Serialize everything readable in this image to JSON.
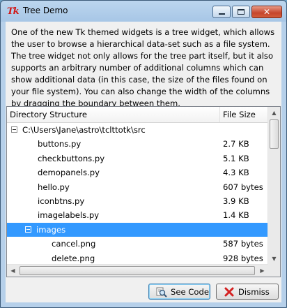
{
  "window": {
    "title": "Tree Demo",
    "app_icon_text": "Tk"
  },
  "description": "One of the new Tk themed widgets is a tree widget, which allows the user to browse a hierarchical data-set such as a file system. The tree widget not only allows for the tree part itself, but it also supports an arbitrary number of additional columns which can show additional data (in this case, the size of the files found on your file system). You can also change the width of the columns by dragging the boundary between them.",
  "tree": {
    "columns": [
      "Directory Structure",
      "File Size"
    ],
    "rows": [
      {
        "name": "C:\\Users\\Jane\\astro\\tclttotk\\src",
        "size": "",
        "level": 0,
        "toggle": true,
        "selected": false
      },
      {
        "name": "buttons.py",
        "size": "2.7 KB",
        "level": 1,
        "toggle": false,
        "selected": false
      },
      {
        "name": "checkbuttons.py",
        "size": "5.1 KB",
        "level": 1,
        "toggle": false,
        "selected": false
      },
      {
        "name": "demopanels.py",
        "size": "4.3 KB",
        "level": 1,
        "toggle": false,
        "selected": false
      },
      {
        "name": "hello.py",
        "size": "607 bytes",
        "level": 1,
        "toggle": false,
        "selected": false
      },
      {
        "name": "iconbtns.py",
        "size": "3.9 KB",
        "level": 1,
        "toggle": false,
        "selected": false
      },
      {
        "name": "imagelabels.py",
        "size": "1.4 KB",
        "level": 1,
        "toggle": false,
        "selected": false
      },
      {
        "name": "images",
        "size": "",
        "level": 1,
        "toggle": true,
        "selected": true
      },
      {
        "name": "cancel.png",
        "size": "587 bytes",
        "level": 2,
        "toggle": false,
        "selected": false
      },
      {
        "name": "delete.png",
        "size": "928 bytes",
        "level": 2,
        "toggle": false,
        "selected": false
      }
    ]
  },
  "buttons": {
    "see_code": "See Code",
    "dismiss": "Dismiss"
  },
  "colors": {
    "selection": "#3399ff",
    "dismiss_icon": "#d42020"
  }
}
